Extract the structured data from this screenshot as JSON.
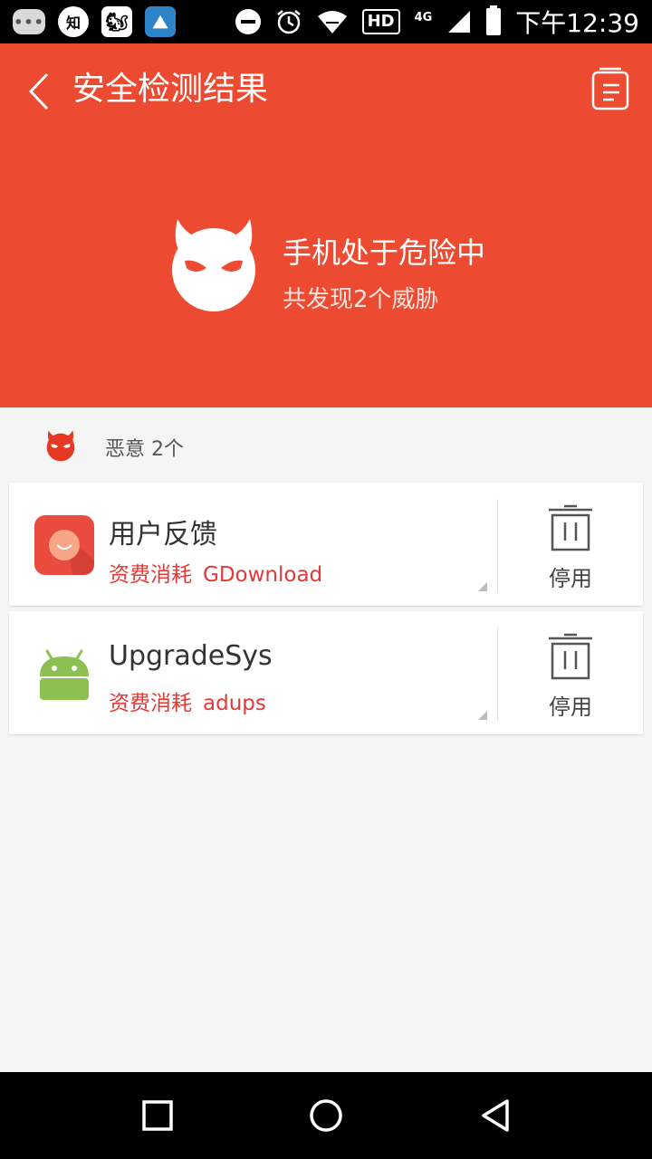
{
  "status_bar": {
    "icons": [
      {
        "name": "message-icon",
        "glyph": "•••"
      },
      {
        "name": "zhihu-icon",
        "glyph": "知"
      },
      {
        "name": "squirrel-icon",
        "glyph": "🐿"
      },
      {
        "name": "bird-icon",
        "glyph": "⛰"
      }
    ],
    "network": "4G",
    "hd": "HD",
    "time": "下午12:39"
  },
  "header": {
    "title": "安全检测结果",
    "hero_title": "手机处于危险中",
    "hero_subtitle": "共发现2个威胁",
    "color": "#ec4a31"
  },
  "section": {
    "label": "恶意 2个"
  },
  "apps": [
    {
      "name": "用户反馈",
      "tag": "资费消耗",
      "source": "GDownload",
      "action_label": "停用",
      "icon": "orange-face-app-icon"
    },
    {
      "name": "UpgradeSys",
      "tag": "资费消耗",
      "source": "adups",
      "action_label": "停用",
      "icon": "android-app-icon"
    }
  ]
}
